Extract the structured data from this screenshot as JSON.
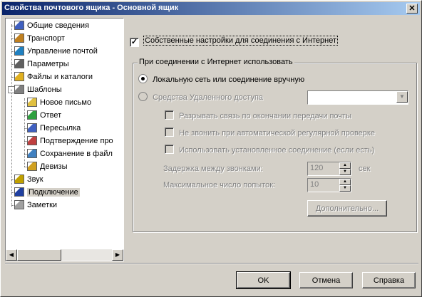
{
  "window": {
    "title": "Свойства почтового ящика - Основной ящик",
    "close_glyph": "✕"
  },
  "tree": {
    "items": [
      {
        "label": "Общие сведения",
        "icon": "info-icon"
      },
      {
        "label": "Транспорт",
        "icon": "transport-icon"
      },
      {
        "label": "Управление почтой",
        "icon": "mail-management-icon"
      },
      {
        "label": "Параметры",
        "icon": "parameters-icon"
      },
      {
        "label": "Файлы и каталоги",
        "icon": "folders-icon"
      },
      {
        "label": "Шаблоны",
        "icon": "templates-icon",
        "expand": "-"
      },
      {
        "label": "Новое письмо",
        "icon": "new-letter-icon"
      },
      {
        "label": "Ответ",
        "icon": "reply-icon"
      },
      {
        "label": "Пересылка",
        "icon": "forward-icon"
      },
      {
        "label": "Подтверждение про",
        "icon": "confirmation-icon"
      },
      {
        "label": "Сохранение в файл",
        "icon": "save-to-file-icon"
      },
      {
        "label": "Девизы",
        "icon": "mottos-icon"
      },
      {
        "label": "Звук",
        "icon": "sound-icon"
      },
      {
        "label": "Подключение",
        "icon": "connection-icon",
        "selected": true
      },
      {
        "label": "Заметки",
        "icon": "notes-icon"
      }
    ],
    "scroll_left": "◀",
    "scroll_right": "▶"
  },
  "panel": {
    "own_settings": {
      "label": "Собственные настройки для соединения с Интернет",
      "checked": true,
      "mark": "✓"
    },
    "group_title": "При соединении с Интернет использовать",
    "radio_local": {
      "label": "Локальную сеть или соединение вручную",
      "selected": true
    },
    "radio_remote": {
      "label": "Средства Удаленного доступа",
      "selected": false
    },
    "remote_combo": {
      "value": "",
      "arrow": "▼"
    },
    "chk_disconnect": {
      "label": "Разрывать связь по окончании передачи почты",
      "checked": false
    },
    "chk_no_dial": {
      "label": "Не звонить при автоматической регулярной проверке",
      "checked": false
    },
    "chk_use_existing": {
      "label": "Использовать установленное соединение (если есть)",
      "checked": false
    },
    "delay": {
      "label": "Задержка между звонками:",
      "value": "120",
      "unit": "сек"
    },
    "attempts": {
      "label": "Максимальное число попыток:",
      "value": "10"
    },
    "advanced_button": "Дополнительно...",
    "spin_up": "▲",
    "spin_down": "▼"
  },
  "buttons": {
    "ok": "OK",
    "cancel": "Отмена",
    "help": "Справка"
  }
}
